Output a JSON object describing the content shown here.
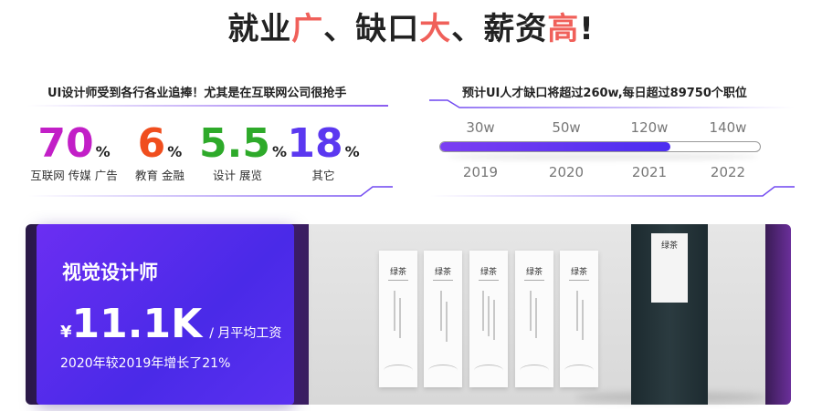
{
  "headline": {
    "part1": "就业",
    "hl1": "广",
    "part2": "、缺口",
    "hl2": "大",
    "part3": "、薪资",
    "hl3": "高",
    "part4": "!"
  },
  "left_panel": {
    "title": "UI设计师受到各行各业追捧！尤其是在互联网公司很抢手",
    "stats": [
      {
        "value": "70",
        "unit": "%",
        "label": "互联网 传媒 广告",
        "color": "#c21fc7"
      },
      {
        "value": "6",
        "unit": "%",
        "label": "教育 金融",
        "color": "#f04e1e"
      },
      {
        "value": "5.5",
        "unit": "%",
        "label": "设计 展览",
        "color": "#2eaa2a"
      },
      {
        "value": "18",
        "unit": "%",
        "label": "其它",
        "color": "#5b38f0"
      }
    ]
  },
  "right_panel": {
    "title": "预计UI人才缺口将超过260w,每日超过89750个职位",
    "values": [
      "30w",
      "50w",
      "120w",
      "140w"
    ],
    "years": [
      "2019",
      "2020",
      "2021",
      "2022"
    ],
    "progress_fraction": 0.72
  },
  "card": {
    "title": "视觉设计师",
    "currency": "¥",
    "salary": "11.1K",
    "salary_unit": "/ 月平均工资",
    "growth": "2020年较2019年增长了21%"
  },
  "product": {
    "tag_name": "绿茶"
  },
  "colors": {
    "accent": "#f0605a",
    "purple": "#5a30f0"
  }
}
